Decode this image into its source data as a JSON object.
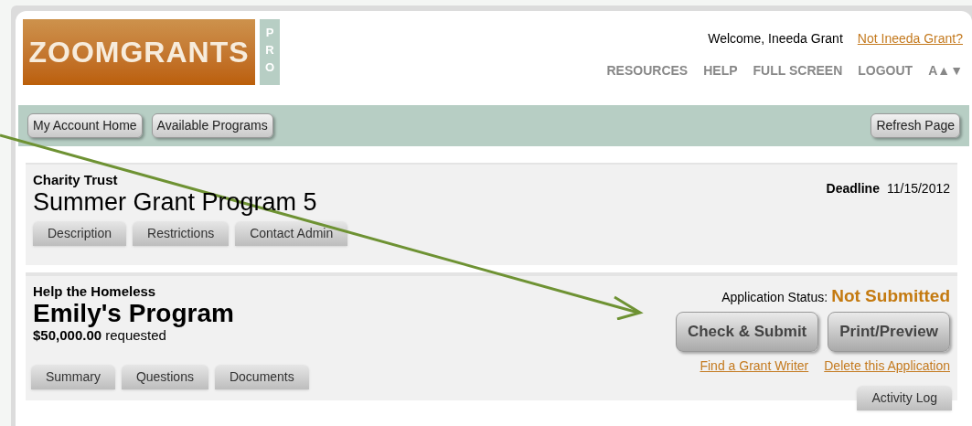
{
  "logo": {
    "text": "ZOOMGRANTS",
    "badge": "PRO"
  },
  "user": {
    "welcome": "Welcome, Ineeda Grant",
    "switch_link": "Not Ineeda Grant?"
  },
  "nav": [
    "RESOURCES",
    "HELP",
    "FULL SCREEN",
    "LOGOUT",
    "A▲▼"
  ],
  "toolbar": {
    "left": [
      "My Account Home",
      "Available Programs"
    ],
    "right": [
      "Refresh Page"
    ]
  },
  "program": {
    "funder": "Charity Trust",
    "title": "Summer Grant Program 5",
    "deadline_label": "Deadline",
    "deadline": "11/15/2012",
    "tabs": [
      "Description",
      "Restrictions",
      "Contact Admin"
    ]
  },
  "application": {
    "organization": "Help the Homeless",
    "title": "Emily's Program",
    "amount": "**$50,000.00** requested",
    "status_label": "Application Status:",
    "status": "Not Submitted",
    "buttons": [
      "Check & Submit",
      "Print/Preview"
    ],
    "links": [
      "Find a Grant Writer",
      "Delete this Application"
    ],
    "tabs": [
      "Summary",
      "Questions",
      "Documents"
    ],
    "log_tab": "Activity Log"
  }
}
